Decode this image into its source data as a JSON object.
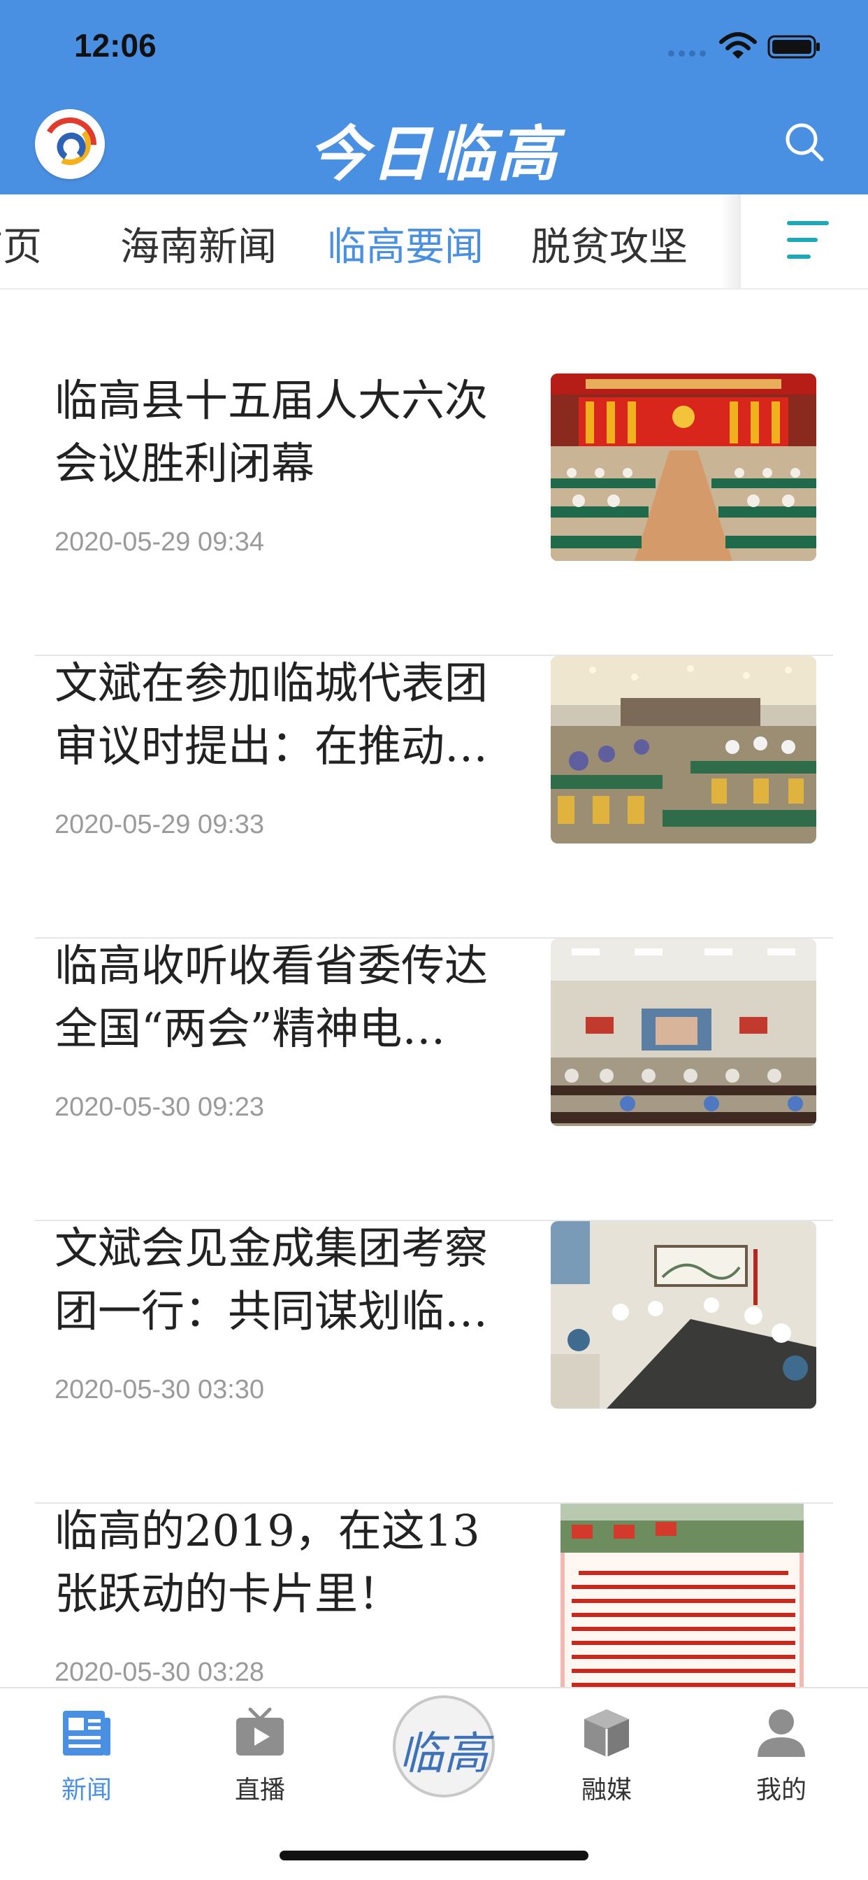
{
  "status_bar": {
    "time": "12:06"
  },
  "header": {
    "title": "今日临高"
  },
  "tabs": [
    {
      "label": "首页"
    },
    {
      "label": "海南新闻"
    },
    {
      "label": "临高要闻"
    },
    {
      "label": "脱贫攻坚"
    }
  ],
  "active_tab": "临高要闻",
  "articles": [
    {
      "title": "临高县十五届人大六次会议胜利闭幕",
      "time": "2020-05-29 09:34"
    },
    {
      "title": "文斌在参加临城代表团审议时提出：在推动…",
      "time": "2020-05-29 09:33"
    },
    {
      "title": "临高收听收看省委传达全国“两会”精神电…",
      "time": "2020-05-30 09:23"
    },
    {
      "title": "文斌会见金成集团考察团一行：共同谋划临…",
      "time": "2020-05-30 03:30"
    },
    {
      "title": "临高的2019，在这13张跃动的卡片里！",
      "time": "2020-05-30 03:28"
    }
  ],
  "bottom_nav": {
    "items": [
      {
        "label": "新闻"
      },
      {
        "label": "直播"
      },
      {
        "label": "融媒"
      },
      {
        "label": "我的"
      }
    ],
    "center_label": "临高"
  },
  "colors": {
    "brand": "#4a90e2",
    "menu_icon": "#1fa8b5"
  }
}
